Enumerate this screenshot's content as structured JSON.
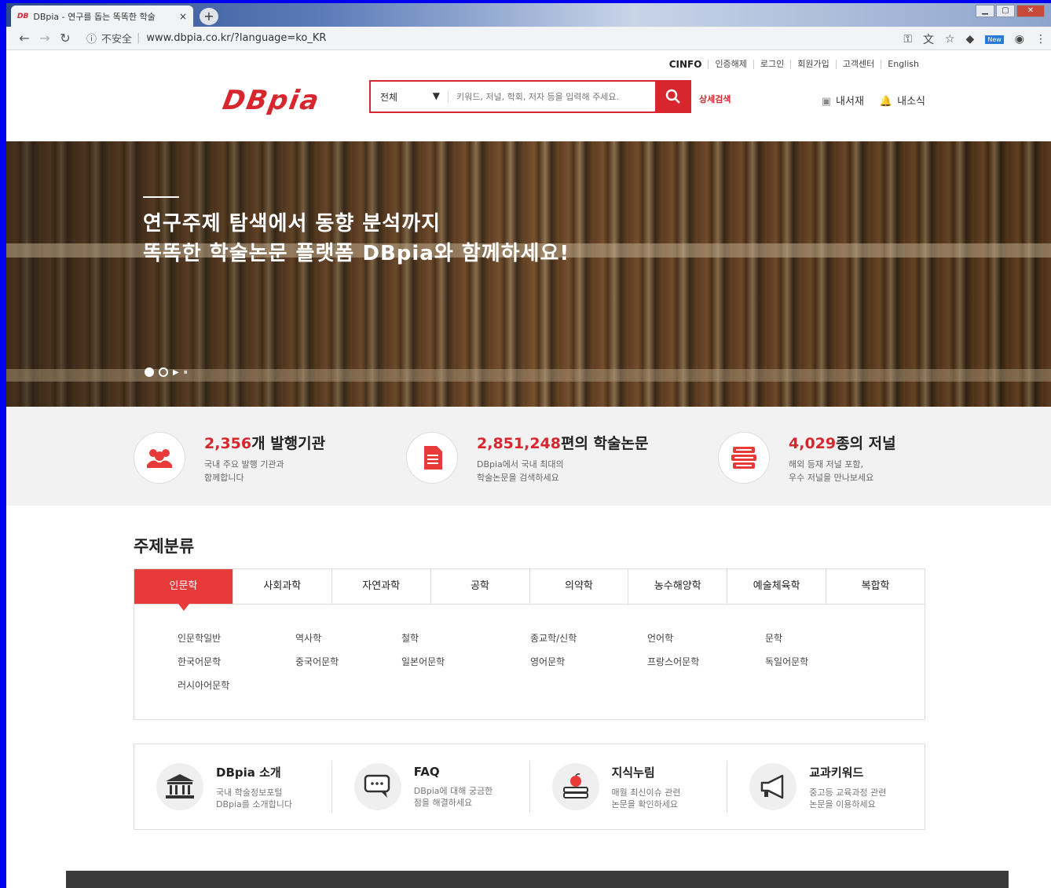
{
  "browser": {
    "tab_title": "DBpia - 연구를 돕는 똑똑한 학술",
    "tab_favicon": "DB",
    "tab_close": "×",
    "new_tab": "+",
    "url_insecure": "不安全",
    "url": "www.dbpia.co.kr/?language=ko_KR",
    "new_badge": "New"
  },
  "header": {
    "top_links": [
      "CINFO",
      "인증해제",
      "로그인",
      "회원가입",
      "고객센터",
      "English"
    ],
    "logo": "DBpia",
    "search": {
      "category": "전체",
      "placeholder": "키워드, 저널, 학회, 저자 등을 입력해 주세요."
    },
    "advanced_search": "상세검색",
    "my_library": "내서재",
    "notices": "내소식"
  },
  "hero": {
    "line1": "연구주제 탐색에서 동향 분석까지",
    "line2": "똑똑한 학술논문 플랫폼 DBpia와 함께하세요!"
  },
  "stats": [
    {
      "num": "2,356",
      "unit": "개 발행기관",
      "desc": "국내 주요 발행 기관과\n함께합니다",
      "icon": "users-icon"
    },
    {
      "num": "2,851,248",
      "unit": "편의 학술논문",
      "desc": "DBpia에서 국내 최대의\n학술논문을 검색하세요",
      "icon": "document-icon"
    },
    {
      "num": "4,029",
      "unit": "종의 저널",
      "desc": "해외 등재 저널 포함,\n우수 저널을 만나보세요",
      "icon": "books-icon"
    }
  ],
  "subjects": {
    "title": "주제분류",
    "tabs": [
      "인문학",
      "사회과학",
      "자연과학",
      "공학",
      "의약학",
      "농수해양학",
      "예술체육학",
      "복합학"
    ],
    "active_tab": 0,
    "items": [
      "인문학일반",
      "역사학",
      "철학",
      "종교학/신학",
      "언어학",
      "문학",
      "한국어문학",
      "중국어문학",
      "일본어문학",
      "영어문학",
      "프랑스어문학",
      "독일어문학",
      "러시아어문학"
    ]
  },
  "services": [
    {
      "title": "DBpia 소개",
      "sub": "국내 학술정보포털\nDBpia를 소개합니다",
      "icon": "building-icon"
    },
    {
      "title": "FAQ",
      "sub": "DBpia에 대해 궁금한\n점을 해결하세요",
      "icon": "chat-icon"
    },
    {
      "title": "지식누림",
      "sub": "매월 최신이슈 관련\n논문을 확인하세요",
      "icon": "apple-book-icon"
    },
    {
      "title": "교과키워드",
      "sub": "중고등 교육과정 관련\n논문을 이용하세요",
      "icon": "megaphone-icon"
    }
  ],
  "colors": {
    "accent": "#d8262f",
    "tab_active": "#e83a38"
  }
}
